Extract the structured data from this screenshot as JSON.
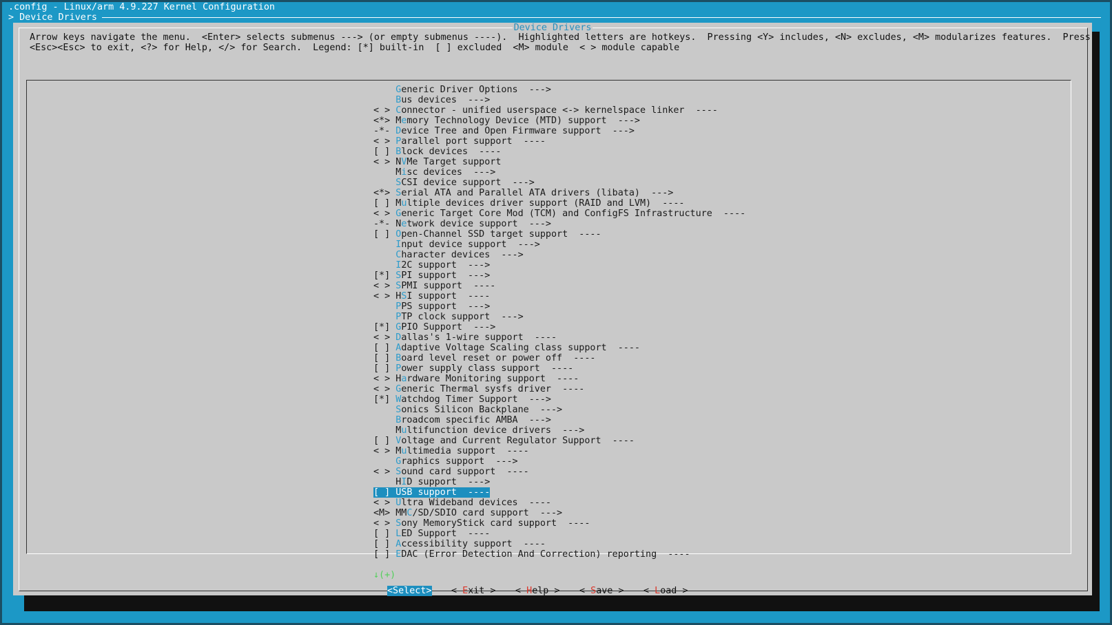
{
  "window_title": ".config - Linux/arm 4.9.227 Kernel Configuration",
  "breadcrumb": "> Device Drivers",
  "dialog": {
    "title": "Device Drivers",
    "help_lines": [
      "Arrow keys navigate the menu.  <Enter> selects submenus ---> (or empty submenus ----).  Highlighted letters are hotkeys.  Pressing <Y> includes, <N> excludes, <M> modularizes features.  Press",
      "<Esc><Esc> to exit, <?> for Help, </> for Search.  Legend: [*] built-in  [ ] excluded  <M> module  < > module capable"
    ]
  },
  "menu": {
    "selected_index": 39,
    "more_indicator": "↓(+)",
    "items": [
      {
        "prefix": "   ",
        "hotkey": "G",
        "rest": "eneric Driver Options  --->",
        "pre": ""
      },
      {
        "prefix": "   ",
        "hotkey": "B",
        "rest": "us devices  --->",
        "pre": ""
      },
      {
        "prefix": "< >",
        "hotkey": "C",
        "rest": "onnector - unified userspace <-> kernelspace linker  ----",
        "pre": ""
      },
      {
        "prefix": "<*>",
        "hotkey": "e",
        "rest": "mory Technology Device (MTD) support  --->",
        "pre": "M"
      },
      {
        "prefix": "-*-",
        "hotkey": "D",
        "rest": "evice Tree and Open Firmware support  --->",
        "pre": ""
      },
      {
        "prefix": "< >",
        "hotkey": "P",
        "rest": "arallel port support  ----",
        "pre": ""
      },
      {
        "prefix": "[ ]",
        "hotkey": "B",
        "rest": "lock devices  ----",
        "pre": ""
      },
      {
        "prefix": "< >",
        "hotkey": "V",
        "rest": "Me Target support",
        "pre": "N"
      },
      {
        "prefix": "   ",
        "hotkey": "i",
        "rest": "sc devices  --->",
        "pre": "M"
      },
      {
        "prefix": "   ",
        "hotkey": "S",
        "rest": "CSI device support  --->",
        "pre": ""
      },
      {
        "prefix": "<*>",
        "hotkey": "S",
        "rest": "erial ATA and Parallel ATA drivers (libata)  --->",
        "pre": ""
      },
      {
        "prefix": "[ ]",
        "hotkey": "u",
        "rest": "ltiple devices driver support (RAID and LVM)  ----",
        "pre": "M"
      },
      {
        "prefix": "< >",
        "hotkey": "G",
        "rest": "eneric Target Core Mod (TCM) and ConfigFS Infrastructure  ----",
        "pre": ""
      },
      {
        "prefix": "-*-",
        "hotkey": "e",
        "rest": "twork device support  --->",
        "pre": "N"
      },
      {
        "prefix": "[ ]",
        "hotkey": "O",
        "rest": "pen-Channel SSD target support  ----",
        "pre": ""
      },
      {
        "prefix": "   ",
        "hotkey": "I",
        "rest": "nput device support  --->",
        "pre": ""
      },
      {
        "prefix": "   ",
        "hotkey": "C",
        "rest": "haracter devices  --->",
        "pre": ""
      },
      {
        "prefix": "   ",
        "hotkey": "I",
        "rest": "2C support  --->",
        "pre": ""
      },
      {
        "prefix": "[*]",
        "hotkey": "S",
        "rest": "PI support  --->",
        "pre": ""
      },
      {
        "prefix": "< >",
        "hotkey": "S",
        "rest": "PMI support  ----",
        "pre": ""
      },
      {
        "prefix": "< >",
        "hotkey": "S",
        "rest": "I support  ----",
        "pre": "H"
      },
      {
        "prefix": "   ",
        "hotkey": "P",
        "rest": "PS support  --->",
        "pre": ""
      },
      {
        "prefix": "   ",
        "hotkey": "P",
        "rest": "TP clock support  --->",
        "pre": ""
      },
      {
        "prefix": "[*]",
        "hotkey": "G",
        "rest": "PIO Support  --->",
        "pre": ""
      },
      {
        "prefix": "< >",
        "hotkey": "D",
        "rest": "allas's 1-wire support  ----",
        "pre": ""
      },
      {
        "prefix": "[ ]",
        "hotkey": "A",
        "rest": "daptive Voltage Scaling class support  ----",
        "pre": ""
      },
      {
        "prefix": "[ ]",
        "hotkey": "B",
        "rest": "oard level reset or power off  ----",
        "pre": ""
      },
      {
        "prefix": "[ ]",
        "hotkey": "P",
        "rest": "ower supply class support  ----",
        "pre": ""
      },
      {
        "prefix": "< >",
        "hotkey": "a",
        "rest": "rdware Monitoring support  ----",
        "pre": "H"
      },
      {
        "prefix": "< >",
        "hotkey": "G",
        "rest": "eneric Thermal sysfs driver  ----",
        "pre": ""
      },
      {
        "prefix": "[*]",
        "hotkey": "W",
        "rest": "atchdog Timer Support  --->",
        "pre": ""
      },
      {
        "prefix": "   ",
        "hotkey": "S",
        "rest": "onics Silicon Backplane  --->",
        "pre": ""
      },
      {
        "prefix": "   ",
        "hotkey": "B",
        "rest": "roadcom specific AMBA  --->",
        "pre": ""
      },
      {
        "prefix": "   ",
        "hotkey": "u",
        "rest": "ltifunction device drivers  --->",
        "pre": "M"
      },
      {
        "prefix": "[ ]",
        "hotkey": "V",
        "rest": "oltage and Current Regulator Support  ----",
        "pre": ""
      },
      {
        "prefix": "< >",
        "hotkey": "u",
        "rest": "ltimedia support  ----",
        "pre": "M"
      },
      {
        "prefix": "   ",
        "hotkey": "G",
        "rest": "raphics support  --->",
        "pre": ""
      },
      {
        "prefix": "< >",
        "hotkey": "S",
        "rest": "ound card support  ----",
        "pre": ""
      },
      {
        "prefix": "   ",
        "hotkey": "I",
        "rest": "D support  --->",
        "pre": "H"
      },
      {
        "prefix": "[ ]",
        "hotkey": "U",
        "rest": "SB support  ----",
        "pre": ""
      },
      {
        "prefix": "< >",
        "hotkey": "U",
        "rest": "ltra Wideband devices  ----",
        "pre": ""
      },
      {
        "prefix": "<M>",
        "hotkey": "C",
        "rest": "/SD/SDIO card support  --->",
        "pre": "MM"
      },
      {
        "prefix": "< >",
        "hotkey": "S",
        "rest": "ony MemoryStick card support  ----",
        "pre": ""
      },
      {
        "prefix": "[ ]",
        "hotkey": "L",
        "rest": "ED Support  ----",
        "pre": ""
      },
      {
        "prefix": "[ ]",
        "hotkey": "A",
        "rest": "ccessibility support  ----",
        "pre": ""
      },
      {
        "prefix": "[ ]",
        "hotkey": "E",
        "rest": "DAC (Error Detection And Correction) reporting  ----",
        "pre": ""
      }
    ]
  },
  "buttons": [
    {
      "label": "<Select>",
      "hotkey": "",
      "active": true
    },
    {
      "label": "< Exit >",
      "hotkey": "E",
      "active": false
    },
    {
      "label": "< Help >",
      "hotkey": "H",
      "active": false
    },
    {
      "label": "< Save >",
      "hotkey": "S",
      "active": false
    },
    {
      "label": "< Load >",
      "hotkey": "L",
      "active": false
    }
  ]
}
